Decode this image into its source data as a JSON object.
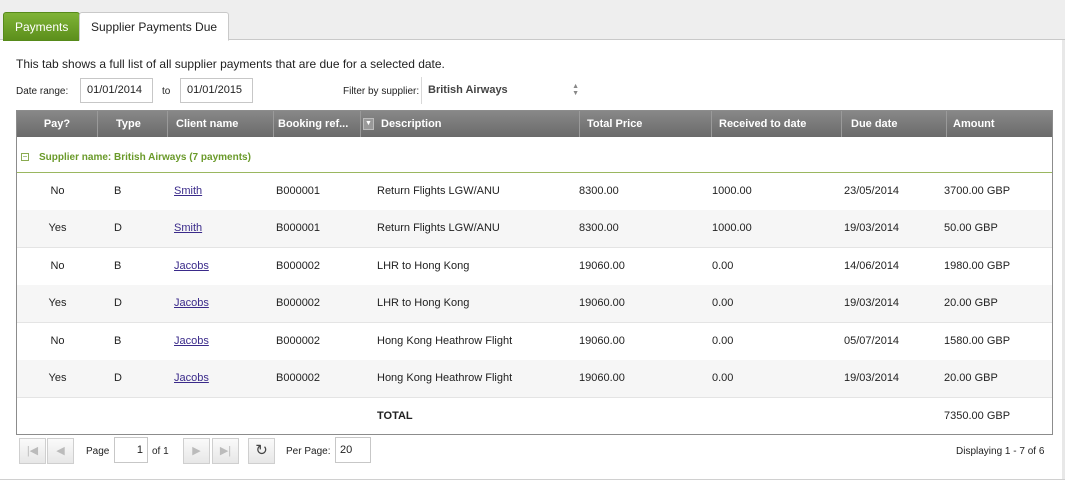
{
  "tabs": {
    "payments": "Payments",
    "supplier_payments_due": "Supplier Payments Due"
  },
  "intro": "This tab shows a full list of all supplier payments that are due for a selected date.",
  "filters": {
    "date_range_label": "Date range:",
    "date_from": "01/01/2014",
    "to_label": "to",
    "date_to": "01/01/2015",
    "supplier_label": "Filter by supplier:",
    "supplier_value": "British Airways"
  },
  "grid": {
    "columns": [
      "Pay?",
      "Type",
      "Client name",
      "Booking ref...",
      "Description",
      "Total Price",
      "Received to date",
      "Due date",
      "Amount"
    ],
    "group_toggle": "−",
    "group_label": "Supplier name: British Airways (7 payments)",
    "rows": [
      {
        "pay": "No",
        "type": "B",
        "client": "Smith",
        "ref": "B000001",
        "description": "Return Flights LGW/ANU",
        "total": "8300.00",
        "received": "1000.00",
        "due": "23/05/2014",
        "amount": "3700.00 GBP"
      },
      {
        "pay": "Yes",
        "type": "D",
        "client": "Smith",
        "ref": "B000001",
        "description": "Return Flights LGW/ANU",
        "total": "8300.00",
        "received": "1000.00",
        "due": "19/03/2014",
        "amount": "50.00 GBP"
      },
      {
        "pay": "No",
        "type": "B",
        "client": "Jacobs",
        "ref": "B000002",
        "description": "LHR to Hong Kong",
        "total": "19060.00",
        "received": "0.00",
        "due": "14/06/2014",
        "amount": "1980.00 GBP"
      },
      {
        "pay": "Yes",
        "type": "D",
        "client": "Jacobs",
        "ref": "B000002",
        "description": "LHR to Hong Kong",
        "total": "19060.00",
        "received": "0.00",
        "due": "19/03/2014",
        "amount": "20.00 GBP"
      },
      {
        "pay": "No",
        "type": "B",
        "client": "Jacobs",
        "ref": "B000002",
        "description": "Hong Kong Heathrow Flight",
        "total": "19060.00",
        "received": "0.00",
        "due": "05/07/2014",
        "amount": "1580.00 GBP"
      },
      {
        "pay": "Yes",
        "type": "D",
        "client": "Jacobs",
        "ref": "B000002",
        "description": "Hong Kong Heathrow Flight",
        "total": "19060.00",
        "received": "0.00",
        "due": "19/03/2014",
        "amount": "20.00 GBP"
      }
    ],
    "total_label": "TOTAL",
    "total_amount": "7350.00 GBP"
  },
  "pager": {
    "page_label": "Page",
    "page_value": "1",
    "of_label": "of 1",
    "per_page_label": "Per Page:",
    "per_page_value": "20",
    "display_info": "Displaying 1 - 7 of 6",
    "icons": {
      "first": "first-page-icon",
      "prev": "prev-page-icon",
      "next": "next-page-icon",
      "last": "last-page-icon",
      "refresh": "refresh-icon"
    }
  },
  "colors": {
    "tab_active": "#6a9e27",
    "group_text": "#6a9a2a",
    "header_bg": "#777777",
    "link": "#3a2a8a"
  }
}
